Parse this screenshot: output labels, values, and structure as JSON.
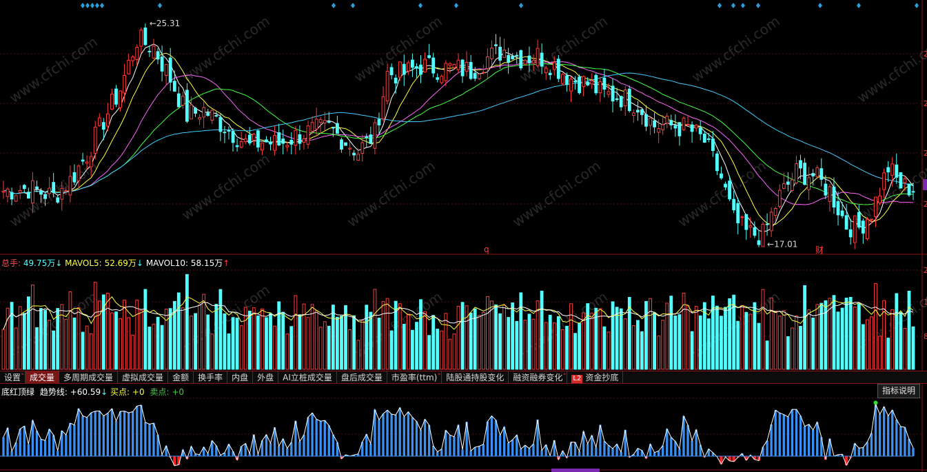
{
  "price_panel": {
    "high_label": "25.31",
    "low_label": "17.01",
    "marker_q": "q",
    "marker_cai": "财",
    "axis_ticks_partial": [
      "2",
      "2",
      "2",
      "2",
      "2"
    ],
    "colors": {
      "up": "#ff3b3b",
      "down": "#54ffff",
      "ma5": "#ffffff",
      "ma10": "#ffff44",
      "ma20": "#ff66ff",
      "ma30": "#44ff44",
      "ma60": "#44ccff",
      "diamond": "#2a9fd8"
    }
  },
  "volume_panel": {
    "label_total": "总手:",
    "value_total": "49.75万",
    "arrow_total": "↓",
    "label_ma5": "MAVOL5:",
    "value_ma5": "52.69万",
    "arrow_ma5": "↓",
    "label_ma10": "MAVOL10:",
    "value_ma10": "58.15万",
    "arrow_ma10": "↑",
    "axis_ticks_partial": [
      "2",
      "1",
      "8"
    ]
  },
  "tabs": [
    {
      "label": "设置",
      "dot": true,
      "active": false
    },
    {
      "label": "成交量",
      "dot": false,
      "active": true
    },
    {
      "label": "多周期成交量",
      "dot": false,
      "active": false
    },
    {
      "label": "虚拟成交量",
      "dot": false,
      "active": false
    },
    {
      "label": "金额",
      "dot": false,
      "active": false
    },
    {
      "label": "换手率",
      "dot": false,
      "active": false
    },
    {
      "label": "内盘",
      "dot": false,
      "active": false
    },
    {
      "label": "外盘",
      "dot": false,
      "active": false
    },
    {
      "label": "AI立桩成交量",
      "dot": false,
      "active": false
    },
    {
      "label": "盘后成交量",
      "dot": false,
      "active": false
    },
    {
      "label": "市盈率(ttm)",
      "dot": true,
      "active": false
    },
    {
      "label": "陆股通持股变化",
      "dot": false,
      "active": false
    },
    {
      "label": "融资融券变化",
      "dot": true,
      "active": false
    },
    {
      "label": "资金抄底",
      "dot": false,
      "active": false,
      "badge": "L2"
    }
  ],
  "indicator_panel": {
    "name": "底红顶绿",
    "label_trend": "趋势线:",
    "value_trend": "+60.59",
    "arrow_trend": "↓",
    "label_buy": "买点:",
    "value_buy": "+0",
    "label_sell": "卖点:",
    "value_sell": "+0",
    "help_button": "指标说明"
  },
  "watermark": "www.cfchi.com",
  "chart_data": [
    {
      "type": "candlestick",
      "ylim": [
        16.5,
        26.0
      ],
      "price_high": 25.31,
      "price_low": 17.01,
      "close_anchors": [
        [
          0,
          18.9
        ],
        [
          6,
          19.0
        ],
        [
          12,
          18.7
        ],
        [
          16,
          19.3
        ],
        [
          20,
          20.3
        ],
        [
          24,
          21.6
        ],
        [
          28,
          22.8
        ],
        [
          32,
          24.7
        ],
        [
          36,
          24.4
        ],
        [
          40,
          23.2
        ],
        [
          44,
          21.8
        ],
        [
          48,
          22.0
        ],
        [
          52,
          21.5
        ],
        [
          56,
          21.0
        ],
        [
          59,
          20.6
        ],
        [
          62,
          20.8
        ],
        [
          66,
          20.7
        ],
        [
          70,
          21.0
        ],
        [
          74,
          21.2
        ],
        [
          78,
          21.3
        ],
        [
          82,
          20.8
        ],
        [
          85,
          20.4
        ],
        [
          89,
          21.1
        ],
        [
          92,
          23.4
        ],
        [
          96,
          23.4
        ],
        [
          100,
          23.7
        ],
        [
          104,
          23.6
        ],
        [
          108,
          23.6
        ],
        [
          112,
          23.5
        ],
        [
          116,
          24.0
        ],
        [
          120,
          24.3
        ],
        [
          124,
          24.0
        ],
        [
          128,
          24.1
        ],
        [
          132,
          23.7
        ],
        [
          136,
          23.2
        ],
        [
          140,
          23.0
        ],
        [
          144,
          22.6
        ],
        [
          148,
          22.5
        ],
        [
          152,
          22.2
        ],
        [
          156,
          21.4
        ],
        [
          160,
          21.4
        ],
        [
          164,
          21.3
        ],
        [
          168,
          20.8
        ],
        [
          172,
          19.4
        ],
        [
          175,
          17.8
        ],
        [
          178,
          17.3
        ],
        [
          182,
          17.2
        ],
        [
          186,
          18.7
        ],
        [
          190,
          19.6
        ],
        [
          194,
          19.5
        ],
        [
          198,
          18.9
        ],
        [
          202,
          17.6
        ],
        [
          205,
          17.5
        ],
        [
          208,
          18.1
        ],
        [
          212,
          19.8
        ],
        [
          215,
          19.1
        ],
        [
          218,
          19.0
        ]
      ],
      "bars": 219
    },
    {
      "type": "bar",
      "series": [
        {
          "name": "总手",
          "values": [
            49.75
          ]
        },
        {
          "name": "MAVOL5",
          "values": [
            52.69
          ]
        },
        {
          "name": "MAVOL10",
          "values": [
            58.15
          ]
        }
      ]
    },
    {
      "type": "bar",
      "series": [
        {
          "name": "趋势线",
          "values": [
            60.59
          ]
        },
        {
          "name": "买点",
          "values": [
            0
          ]
        },
        {
          "name": "卖点",
          "values": [
            0
          ]
        }
      ]
    }
  ]
}
